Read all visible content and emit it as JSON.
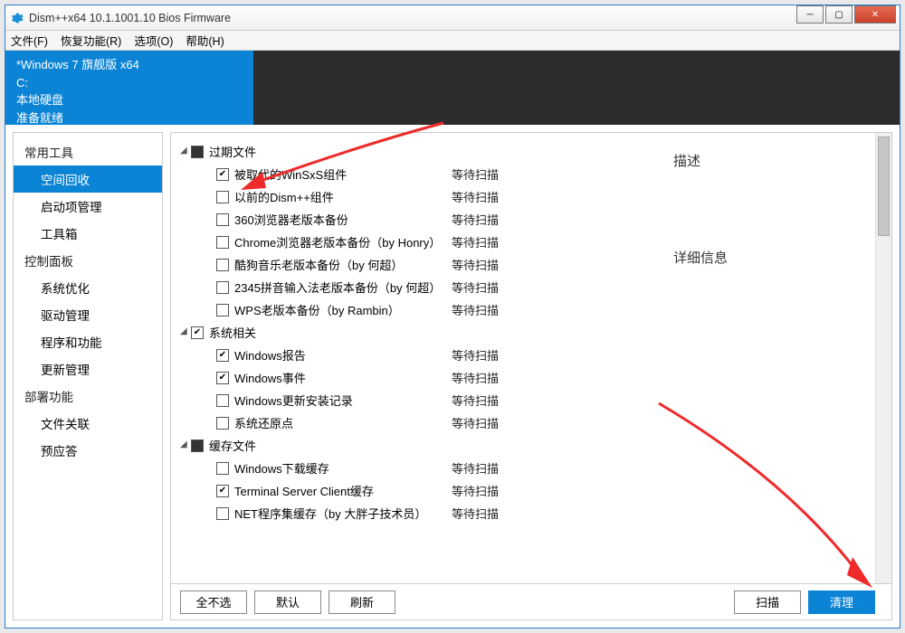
{
  "window": {
    "title": "Dism++x64 10.1.1001.10 Bios Firmware"
  },
  "menu": {
    "file": "文件(F)",
    "recover": "恢复功能(R)",
    "options": "选项(O)",
    "help": "帮助(H)"
  },
  "info": {
    "os": "*Windows 7 旗舰版 x64",
    "drive": "C:",
    "disk": "本地硬盘",
    "state": "准备就绪"
  },
  "sidebar": {
    "groups": [
      {
        "label": "常用工具",
        "items": [
          {
            "label": "空间回收",
            "active": true
          },
          {
            "label": "启动项管理"
          },
          {
            "label": "工具箱"
          }
        ]
      },
      {
        "label": "控制面板",
        "items": [
          {
            "label": "系统优化"
          },
          {
            "label": "驱动管理"
          },
          {
            "label": "程序和功能"
          },
          {
            "label": "更新管理"
          }
        ]
      },
      {
        "label": "部署功能",
        "items": [
          {
            "label": "文件关联"
          },
          {
            "label": "预应答"
          }
        ]
      }
    ]
  },
  "tree": {
    "cats": [
      {
        "label": "过期文件",
        "state": "ind",
        "items": [
          {
            "label": "被取代的WinSxS组件",
            "checked": true,
            "status": "等待扫描"
          },
          {
            "label": "以前的Dism++组件",
            "checked": false,
            "status": "等待扫描"
          },
          {
            "label": "360浏览器老版本备份",
            "checked": false,
            "status": "等待扫描"
          },
          {
            "label": "Chrome浏览器老版本备份（by Honry）",
            "checked": false,
            "status": "等待扫描"
          },
          {
            "label": "酷狗音乐老版本备份（by 何超）",
            "checked": false,
            "status": "等待扫描"
          },
          {
            "label": "2345拼音输入法老版本备份（by 何超）",
            "checked": false,
            "status": "等待扫描"
          },
          {
            "label": "WPS老版本备份（by Rambin）",
            "checked": false,
            "status": "等待扫描"
          }
        ]
      },
      {
        "label": "系统相关",
        "state": "checked",
        "items": [
          {
            "label": "Windows报告",
            "checked": true,
            "status": "等待扫描"
          },
          {
            "label": "Windows事件",
            "checked": true,
            "status": "等待扫描"
          },
          {
            "label": "Windows更新安装记录",
            "checked": false,
            "status": "等待扫描"
          },
          {
            "label": "系统还原点",
            "checked": false,
            "status": "等待扫描"
          }
        ]
      },
      {
        "label": "缓存文件",
        "state": "ind",
        "items": [
          {
            "label": "Windows下载缓存",
            "checked": false,
            "status": "等待扫描"
          },
          {
            "label": "Terminal Server Client缓存",
            "checked": true,
            "status": "等待扫描"
          },
          {
            "label": "NET程序集缓存（by 大胖子技术员）",
            "checked": false,
            "status": "等待扫描"
          }
        ]
      }
    ]
  },
  "right": {
    "desc": "描述",
    "detail": "详细信息"
  },
  "footer": {
    "none": "全不选",
    "def": "默认",
    "refresh": "刷新",
    "scan": "扫描",
    "clean": "清理"
  }
}
